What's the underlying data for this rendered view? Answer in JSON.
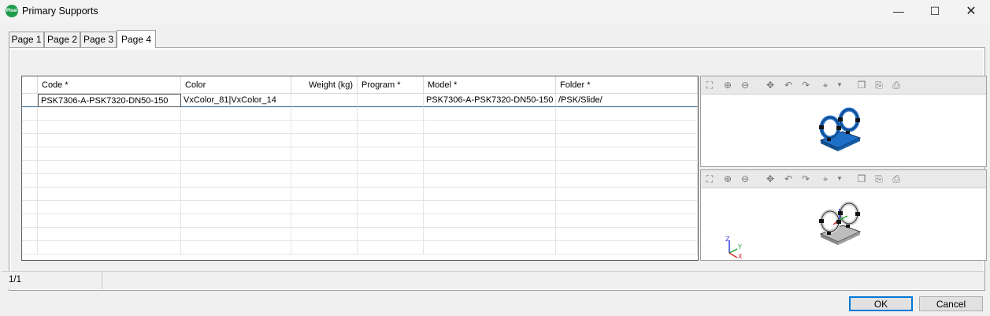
{
  "window": {
    "title": "Primary Supports",
    "app_icon_text": "Pixel",
    "minimize_glyph": "—",
    "maximize_glyph": "☐",
    "close_glyph": "✕"
  },
  "tabs": [
    {
      "label": "Page 1",
      "active": false
    },
    {
      "label": "Page 2",
      "active": false
    },
    {
      "label": "Page 3",
      "active": false
    },
    {
      "label": "Page 4",
      "active": true
    }
  ],
  "grid": {
    "columns": [
      "Code *",
      "Color",
      "Weight (kg)",
      "Program *",
      "Model *",
      "Folder *"
    ],
    "rows": [
      [
        "PSK7306-A-PSK7320-DN50-150",
        "VxColor_81|VxColor_14",
        "",
        "",
        "PSK7306-A-PSK7320-DN50-150",
        "/PSK/Slide/"
      ]
    ]
  },
  "viewport_toolbar": {
    "icons": [
      "zoom-extents-icon",
      "zoom-in-icon",
      "zoom-out-icon",
      "pan-icon",
      "rotate-left-icon",
      "rotate-right-icon",
      "view-orient-icon",
      "dropdown-arrow-icon",
      "view-cube-icon",
      "export-icon",
      "print-icon"
    ]
  },
  "axes": {
    "z": "Z",
    "y": "Y",
    "x": "X"
  },
  "status": {
    "count": "1/1"
  },
  "buttons": {
    "ok": "OK",
    "cancel": "Cancel"
  },
  "colors": {
    "model_blue": "#1e6fc8",
    "model_gray": "#c8c8c8",
    "accent": "#0078d7"
  }
}
